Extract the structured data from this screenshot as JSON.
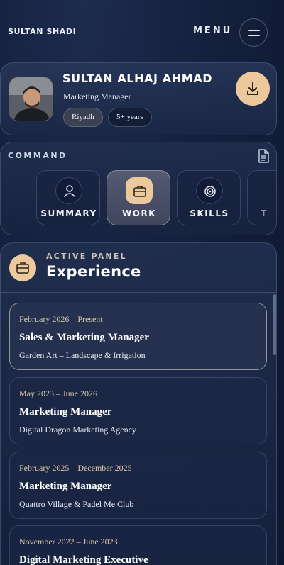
{
  "header": {
    "brand": "SULTAN SHADI",
    "menu_label": "MENU"
  },
  "profile": {
    "name": "SULTAN ALHAJ AHMAD",
    "role": "Marketing Manager",
    "chips": [
      "Riyadh",
      "5+ years"
    ]
  },
  "command": {
    "label": "COMMAND",
    "tabs": [
      {
        "label": "SUMMARY",
        "icon": "user-icon"
      },
      {
        "label": "WORK",
        "icon": "briefcase-icon",
        "active": true
      },
      {
        "label": "SKILLS",
        "icon": "target-icon"
      },
      {
        "label": "T",
        "icon": ""
      }
    ]
  },
  "panel": {
    "eyebrow": "ACTIVE PANEL",
    "title": "Experience",
    "jobs": [
      {
        "date": "February 2026 – Present",
        "title": "Sales & Marketing Manager",
        "company": "Garden Art – Landscape & Irrigation"
      },
      {
        "date": "May 2023 – June 2026",
        "title": "Marketing Manager",
        "company": "Digital Dragon Marketing Agency"
      },
      {
        "date": "February 2025 – December 2025",
        "title": "Marketing Manager",
        "company": "Quattro Village & Padel Me Club"
      },
      {
        "date": "November 2022 – June 2023",
        "title": "Digital Marketing Executive",
        "company": ""
      }
    ]
  },
  "colors": {
    "accent": "#ecc99d",
    "background": "#14203d"
  }
}
